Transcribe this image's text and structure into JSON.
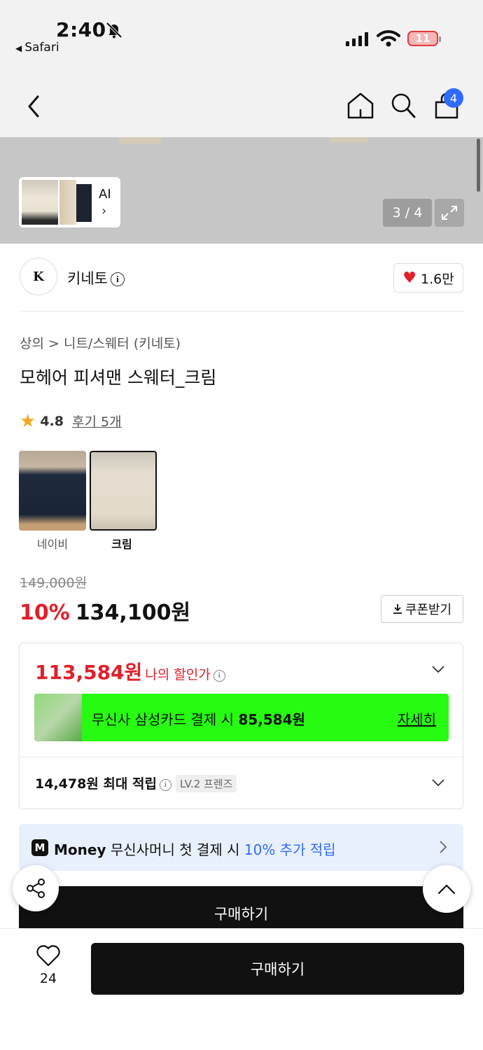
{
  "status_bar": {
    "time": "2:40",
    "back_app": "Safari",
    "battery": "11"
  },
  "nav": {
    "cart_count": "4"
  },
  "gallery": {
    "ai_label": "AI",
    "page_indicator": "3 / 4"
  },
  "brand": {
    "name": "키네토",
    "logo_text": "K",
    "likes": "1.6만"
  },
  "product": {
    "breadcrumb": "상의 > 니트/스웨터 (키네토)",
    "title": "모헤어 피셔맨 스웨터_크림",
    "rating": "4.8",
    "reviews": "후기 5개",
    "colors": [
      {
        "label": "네이비"
      },
      {
        "label": "크림"
      }
    ],
    "original_price": "149,000원",
    "discount": "10%",
    "price": "134,100원",
    "coupon_label": "쿠폰받기"
  },
  "benefits": {
    "my_price": "113,584원",
    "my_price_label": "나의 할인가",
    "card_offer_prefix": "무신사 삼성카드 결제 시 ",
    "card_offer_amount": "85,584원",
    "card_detail": "자세히",
    "points": "14,478원 최대 적립",
    "level": "LV.2 프렌즈"
  },
  "money_banner": {
    "icon": "M",
    "brand": "Money",
    "text": " 무신사머니 첫 결제 시 ",
    "accent": "10% 추가 적립"
  },
  "actions": {
    "buy_peek": "구매하기",
    "wish_count": "24",
    "buy": "구매하기"
  },
  "colors": {
    "accent_red": "#e0202a",
    "accent_blue": "#2f6bff",
    "card_green": "#26fb11",
    "star": "#f5a623"
  }
}
